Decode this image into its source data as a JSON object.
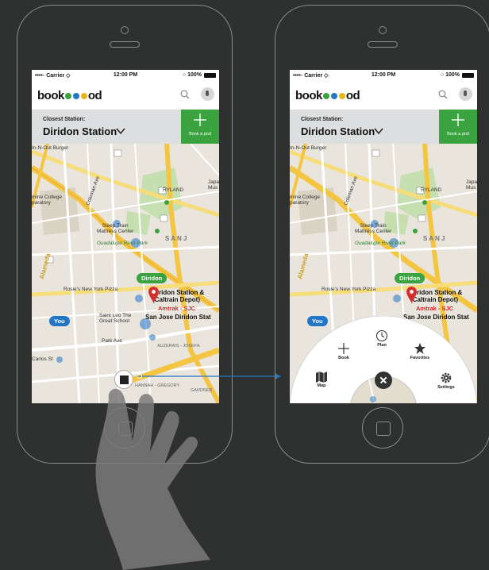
{
  "status_bar": {
    "carrier": "••••◦ Carrier ◇",
    "time": "12:00 PM",
    "battery": "○ 100%"
  },
  "app": {
    "logo_before": "book",
    "logo_after": "od"
  },
  "station": {
    "label": "Closest Station:",
    "name": "Diridon Station"
  },
  "book_button": {
    "label": "Book a pod"
  },
  "map_labels": {
    "burger": "In-N-Out Burger",
    "college": "mine College\nparatory",
    "sleep_train": "Sleep Train\nMattress Center",
    "guadalupe": "Guadalupe River Park",
    "rosies": "Rosie's New York Pizza",
    "diridon_station": "Diridon Station &\n(Caltrain Depot)",
    "amtrak": "Amtrak - SJC",
    "sj_diridon": "San Jose Diridon Stat",
    "saint_leo": "Saint Leo The\nGreat School",
    "park_ave": "Park Ave",
    "carlos": "Carlos St",
    "coleman": "Coleman Ave",
    "ryland": "RYLAND",
    "san_jose": "S A N   J",
    "japan": "Japa\nMus",
    "alameda": "Alameda",
    "hannah": "HANNAH - GREGORY",
    "auzerais": "AUZERAIS - JOSEFA",
    "gardner": "GARDNER"
  },
  "map_pills": {
    "diridon": "Diridon",
    "you": "You"
  },
  "radial_menu": [
    {
      "label": "Book",
      "icon": "plus-icon"
    },
    {
      "label": "Plan",
      "icon": "clock-icon"
    },
    {
      "label": "Favorites",
      "icon": "star-icon"
    },
    {
      "label": "Map",
      "icon": "map-icon"
    },
    {
      "label": "Settings",
      "icon": "gear-icon"
    }
  ],
  "colors": {
    "background": "#2f3030",
    "accent_green": "#3aa340",
    "accent_blue": "#2176c7",
    "pin_red": "#d32f2f"
  }
}
